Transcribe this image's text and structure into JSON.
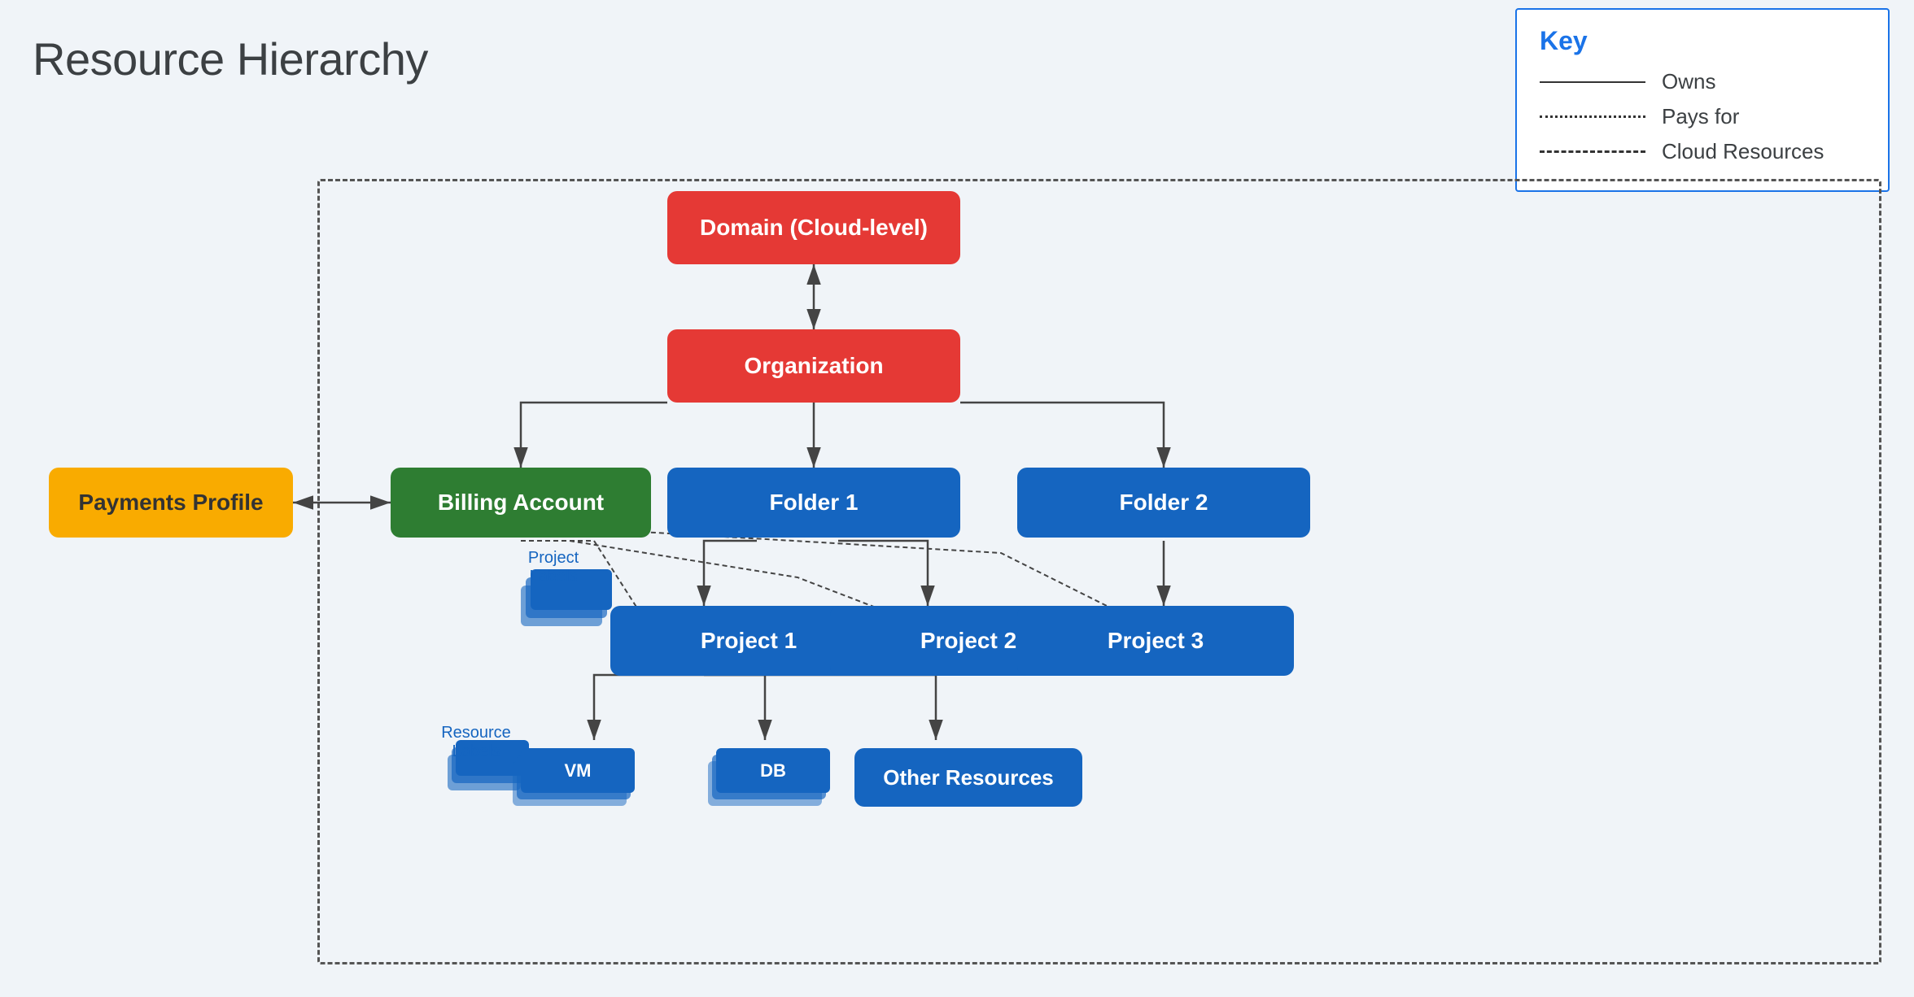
{
  "page": {
    "title": "Resource Hierarchy"
  },
  "key": {
    "title": "Key",
    "items": [
      {
        "type": "solid",
        "label": "Owns"
      },
      {
        "type": "dotted",
        "label": "Pays for"
      },
      {
        "type": "dashed",
        "label": "Cloud Resources"
      }
    ]
  },
  "nodes": {
    "domain": {
      "label": "Domain (Cloud-level)"
    },
    "organization": {
      "label": "Organization"
    },
    "payments_profile": {
      "label": "Payments Profile"
    },
    "billing_account": {
      "label": "Billing Account"
    },
    "folder1": {
      "label": "Folder 1"
    },
    "folder2": {
      "label": "Folder 2"
    },
    "project1": {
      "label": "Project 1"
    },
    "project2": {
      "label": "Project 2"
    },
    "project3": {
      "label": "Project 3"
    },
    "vm": {
      "label": "VM"
    },
    "db": {
      "label": "DB"
    },
    "other_resources": {
      "label": "Other Resources"
    },
    "project_labels": {
      "label": "Project\nLabels"
    },
    "resource_labels": {
      "label": "Resource\nLabels"
    }
  }
}
